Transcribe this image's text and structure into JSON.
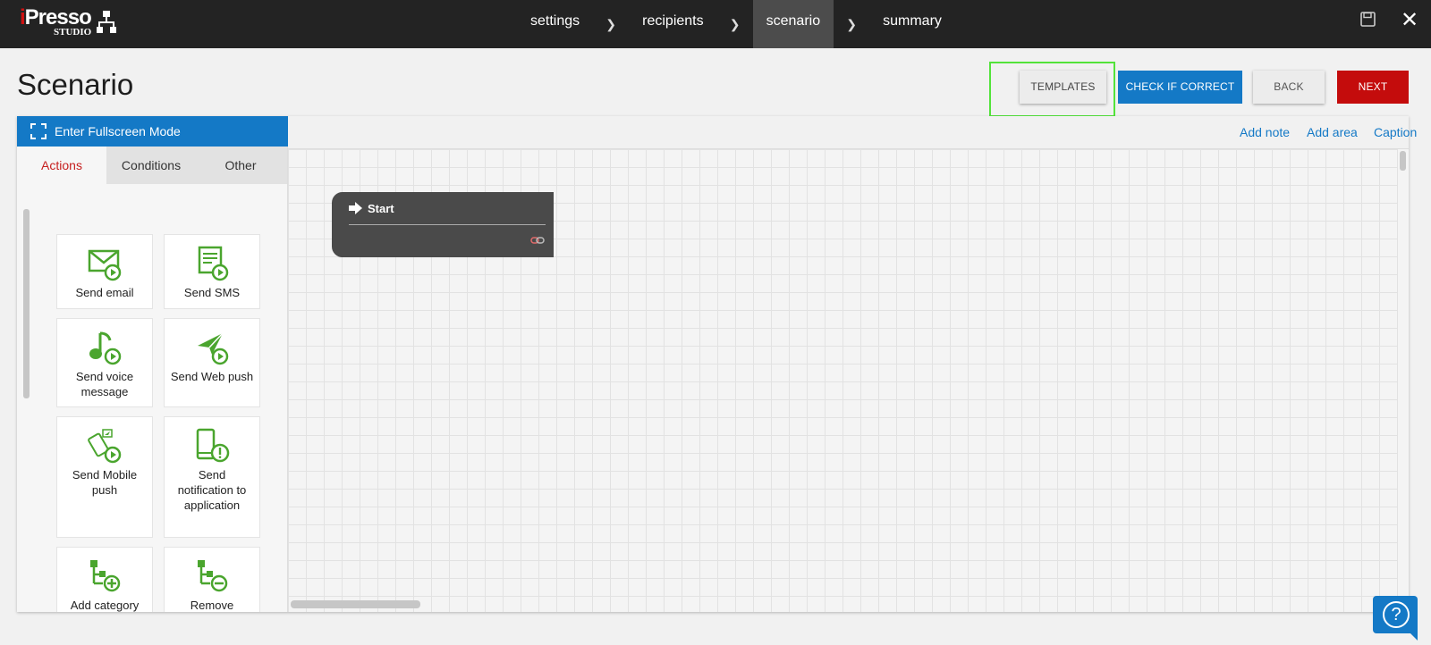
{
  "topbar": {
    "logo_brand": "iPresso",
    "logo_sub": "STUDIO",
    "steps": [
      "settings",
      "recipients",
      "scenario",
      "summary"
    ],
    "active_step": "scenario"
  },
  "page": {
    "title": "Scenario",
    "buttons": {
      "templates": "TEMPLATES",
      "check": "CHECK IF CORRECT",
      "back": "BACK",
      "next": "NEXT"
    }
  },
  "editor": {
    "fullscreen_label": "Enter Fullscreen Mode",
    "toolbar_links": [
      "Add note",
      "Add area",
      "Caption"
    ],
    "tabs": [
      "Actions",
      "Conditions",
      "Other"
    ],
    "active_tab": "Actions",
    "actions": [
      {
        "label": "Send email",
        "icon": "email-play-icon"
      },
      {
        "label": "Send SMS",
        "icon": "sms-play-icon"
      },
      {
        "label": "Send voice message",
        "icon": "voice-play-icon"
      },
      {
        "label": "Send Web push",
        "icon": "web-push-play-icon"
      },
      {
        "label": "Send Mobile push",
        "icon": "mobile-push-play-icon"
      },
      {
        "label": "Send notification to application",
        "icon": "app-notification-icon"
      },
      {
        "label": "Add category",
        "icon": "add-category-icon"
      },
      {
        "label": "Remove category",
        "icon": "remove-category-icon"
      }
    ],
    "start_node": {
      "label": "Start"
    }
  },
  "colors": {
    "accent_blue": "#1479c6",
    "next_red": "#c40c0c",
    "icon_green": "#4aa52e",
    "highlight_green": "#53e33a"
  }
}
